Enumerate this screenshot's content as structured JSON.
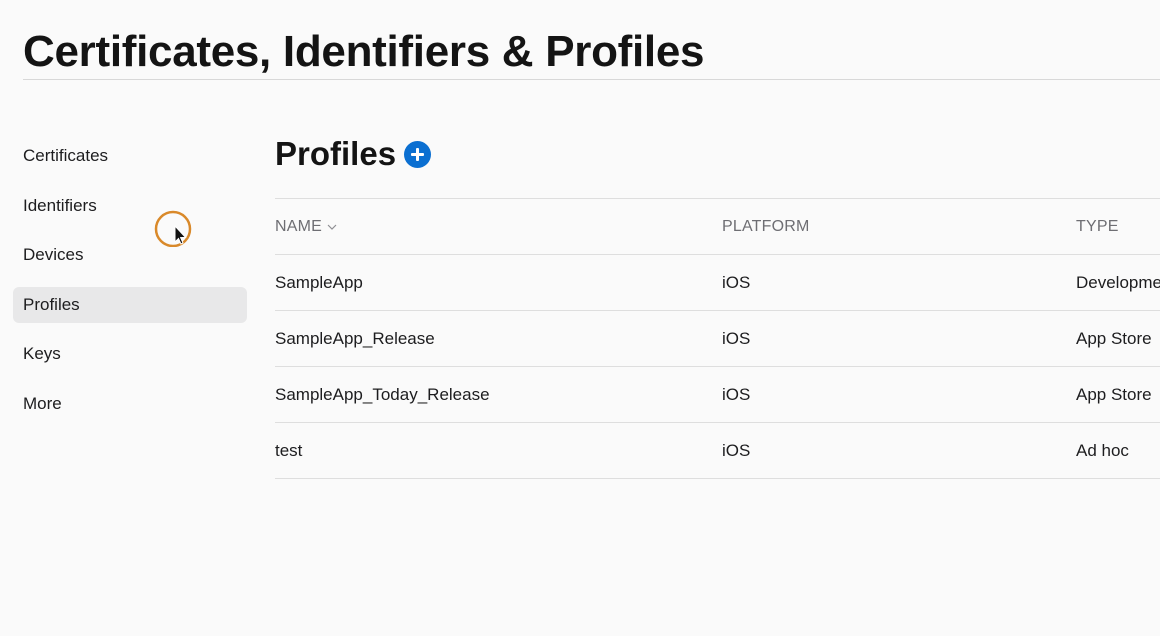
{
  "header": {
    "title": "Certificates, Identifiers & Profiles"
  },
  "sidebar": {
    "items": [
      {
        "label": "Certificates"
      },
      {
        "label": "Identifiers"
      },
      {
        "label": "Devices"
      },
      {
        "label": "Profiles",
        "selected": true
      },
      {
        "label": "Keys"
      },
      {
        "label": "More"
      }
    ]
  },
  "main": {
    "section_title": "Profiles",
    "add_icon": "plus-circle-icon",
    "table": {
      "columns": [
        "NAME",
        "PLATFORM",
        "TYPE"
      ],
      "sort_icon": "chevron-down-icon",
      "rows": [
        {
          "name": "SampleApp",
          "platform": "iOS",
          "type": "Development"
        },
        {
          "name": "SampleApp_Release",
          "platform": "iOS",
          "type": "App Store"
        },
        {
          "name": "SampleApp_Today_Release",
          "platform": "iOS",
          "type": "App Store"
        },
        {
          "name": "test",
          "platform": "iOS",
          "type": "Ad hoc"
        }
      ]
    }
  },
  "colors": {
    "accent": "#0b6fd1",
    "selected_bg": "#e8e8e9",
    "cursor_ring": "#d9892a"
  }
}
